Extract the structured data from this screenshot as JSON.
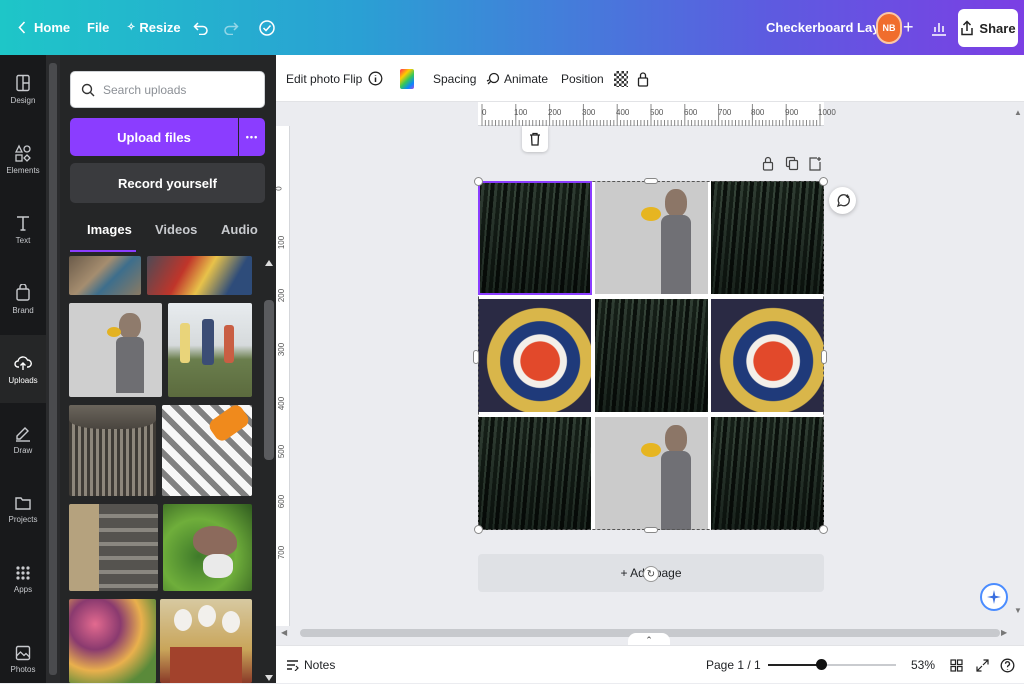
{
  "topbar": {
    "home_label": "Home",
    "file_label": "File",
    "resize_label": "Resize",
    "doc_title": "Checkerboard Layout",
    "avatar_initials": "NB",
    "share_label": "Share"
  },
  "rail": {
    "items": [
      {
        "label": "Design",
        "icon": "layout-icon"
      },
      {
        "label": "Elements",
        "icon": "shapes-icon"
      },
      {
        "label": "Text",
        "icon": "text-icon"
      },
      {
        "label": "Brand",
        "icon": "brand-icon"
      },
      {
        "label": "Uploads",
        "icon": "upload-cloud-icon"
      },
      {
        "label": "Draw",
        "icon": "pen-icon"
      },
      {
        "label": "Projects",
        "icon": "folder-icon"
      },
      {
        "label": "Apps",
        "icon": "grid-icon"
      },
      {
        "label": "Photos",
        "icon": "photo-icon"
      }
    ],
    "active": "Uploads"
  },
  "panel": {
    "search_placeholder": "Search uploads",
    "upload_label": "Upload files",
    "more_label": "•••",
    "record_label": "Record yourself",
    "tabs": [
      "Images",
      "Videos",
      "Audio"
    ],
    "active_tab": "Images"
  },
  "toolbar": {
    "edit_photo": "Edit photo",
    "flip": "Flip",
    "spacing": "Spacing",
    "animate": "Animate",
    "position": "Position"
  },
  "ruler": {
    "top_ticks": [
      "0",
      "100",
      "200",
      "300",
      "400",
      "500",
      "600",
      "700",
      "800",
      "900",
      "1000"
    ],
    "left_ticks": [
      "0",
      "100",
      "200",
      "300",
      "400",
      "500",
      "600",
      "700"
    ]
  },
  "canvas": {
    "add_page_label": "+ Add page",
    "grid": [
      "waterfall",
      "man",
      "waterfall",
      "koi",
      "waterfall",
      "koi",
      "waterfall",
      "man",
      "waterfall"
    ]
  },
  "bottombar": {
    "notes_label": "Notes",
    "page_label": "Page 1 / 1",
    "zoom_label": "53%",
    "zoom_fraction": 0.42
  },
  "colors": {
    "accent": "#8b3dff",
    "rail_bg": "#18191b",
    "panel_bg": "#252627"
  }
}
